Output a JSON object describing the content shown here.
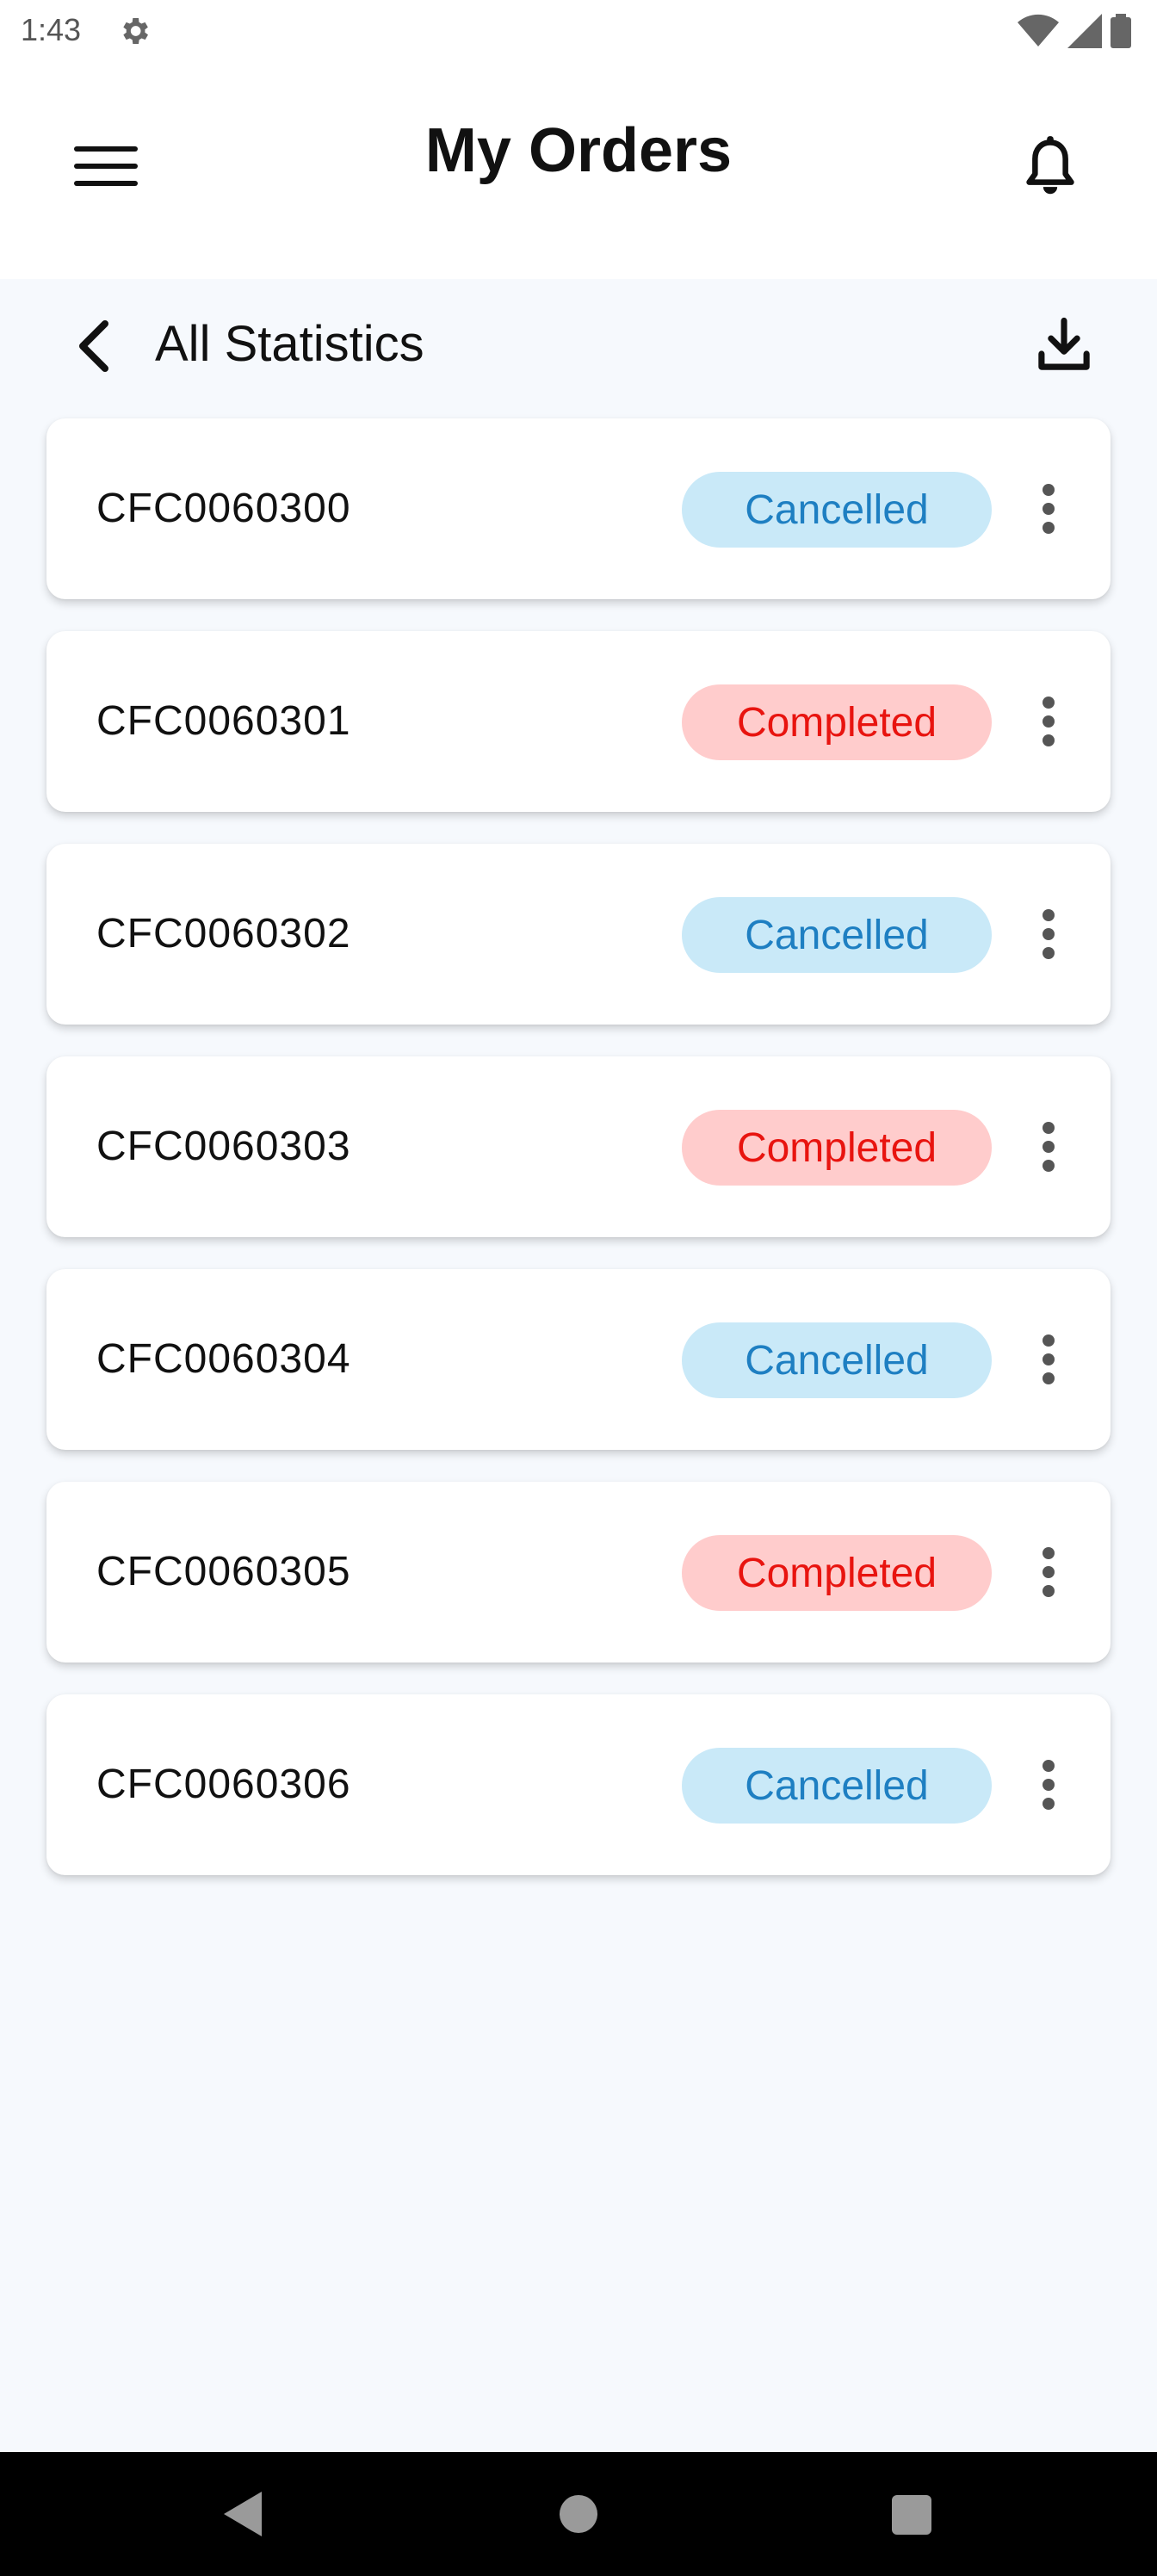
{
  "status_bar": {
    "time": "1:43"
  },
  "header": {
    "title": "My Orders",
    "menu_icon": "hamburger-menu-icon",
    "notification_icon": "bell-icon"
  },
  "sub_header": {
    "title": "All Statistics",
    "back_icon": "chevron-left-icon",
    "download_icon": "download-icon"
  },
  "orders": [
    {
      "id": "CFC0060300",
      "status": "Cancelled"
    },
    {
      "id": "CFC0060301",
      "status": "Completed"
    },
    {
      "id": "CFC0060302",
      "status": "Cancelled"
    },
    {
      "id": "CFC0060303",
      "status": "Completed"
    },
    {
      "id": "CFC0060304",
      "status": "Cancelled"
    },
    {
      "id": "CFC0060305",
      "status": "Completed"
    },
    {
      "id": "CFC0060306",
      "status": "Cancelled"
    }
  ],
  "colors": {
    "cancelled_bg": "#c9e9f8",
    "cancelled_text": "#1e7fc2",
    "completed_bg": "#ffcccc",
    "completed_text": "#e8140f",
    "page_bg": "#f6f9fd"
  }
}
